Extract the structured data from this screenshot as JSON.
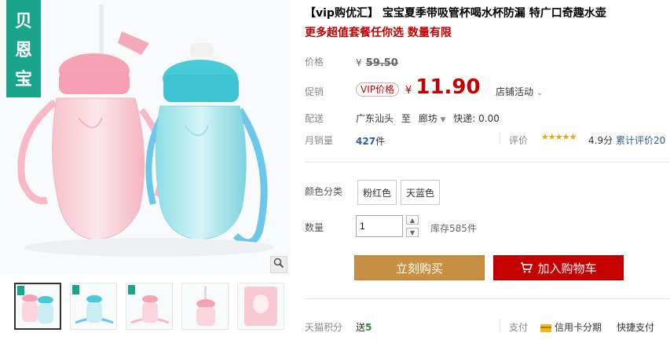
{
  "brand": {
    "badge_chars": [
      "贝",
      "恩",
      "宝"
    ]
  },
  "product": {
    "title": "【vip购优汇】 宝宝夏季带吸管杯喝水杯防漏 特广口奇趣水壶",
    "subtitle": "更多超值套餐任你选 数量有限"
  },
  "price": {
    "label": "价格",
    "currency": "¥",
    "original": "59.50"
  },
  "promo": {
    "label": "促销",
    "vip_tag": "VIP价格",
    "currency": "¥",
    "price": "11.90",
    "store_activity": "店铺活动"
  },
  "shipping": {
    "label": "配送",
    "from": "广东汕头",
    "to_word": "至",
    "dest": "廊坊",
    "fee_label": "快递:",
    "fee": "0.00"
  },
  "sales": {
    "label": "月销量",
    "count": "427",
    "unit": "件",
    "review_label": "评价",
    "stars": "★★★★★",
    "score": "4.9分",
    "cumulative_reviews": "累计评价20"
  },
  "color": {
    "label": "颜色分类",
    "options": [
      "粉红色",
      "天蓝色"
    ]
  },
  "quantity": {
    "label": "数量",
    "value": "1",
    "stock": "库存585件",
    "up": "▲",
    "down": "▼"
  },
  "actions": {
    "buy_now": "立刻购买",
    "add_to_cart": "加入购物车"
  },
  "footer": {
    "points_label": "天猫积分",
    "points_prefix": "送",
    "points_value": "5",
    "pay_label": "支付",
    "credit_installment": "信用卡分期",
    "quick_pay": "快捷支付"
  },
  "ui": {
    "zoom_icon": "magnifier-icon",
    "cart_icon": "cart-icon"
  },
  "colors": {
    "accent_red": "#c40000",
    "brand_green": "#18a58b",
    "buy_gold": "#c79043"
  }
}
